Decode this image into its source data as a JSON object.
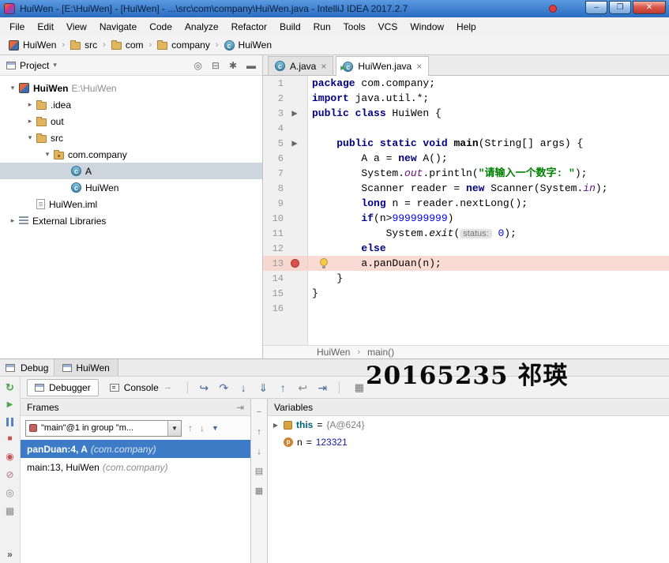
{
  "colors": {
    "titlebar_blue": "#2e74c8",
    "selection_blue": "#3e7bc6",
    "breakpoint_line_pink": "#fadbd3",
    "breakpoint_red": "#d94f49",
    "keyword": "#000080",
    "string": "#008000",
    "number": "#0000ff",
    "field": "#660e7a",
    "tree_selection": "#cdd6df"
  },
  "titlebar": {
    "title": "HuiWen - [E:\\HuiWen] - [HuiWen] - ...\\src\\com\\company\\HuiWen.java - IntelliJ IDEA 2017.2.7",
    "controls": [
      "notification-icon",
      "minimize-icon",
      "maximize-icon",
      "close-icon"
    ]
  },
  "menu": {
    "items": [
      "File",
      "Edit",
      "View",
      "Navigate",
      "Code",
      "Analyze",
      "Refactor",
      "Build",
      "Run",
      "Tools",
      "VCS",
      "Window",
      "Help"
    ]
  },
  "navbar": {
    "items": [
      {
        "label": "HuiWen",
        "icon": "project-icon"
      },
      {
        "label": "src",
        "icon": "folder-icon"
      },
      {
        "label": "com",
        "icon": "folder-icon"
      },
      {
        "label": "company",
        "icon": "folder-icon"
      },
      {
        "label": "HuiWen",
        "icon": "class-icon"
      }
    ]
  },
  "project": {
    "title": "Project",
    "header_icons": [
      "locate-icon",
      "collapse-all-icon",
      "settings-icon",
      "hide-panel-icon"
    ],
    "tree": [
      {
        "label": "HuiWen",
        "suffix": " E:\\HuiWen",
        "icon": "project-icon",
        "chevron": "down",
        "level": 0,
        "bold": true
      },
      {
        "label": ".idea",
        "icon": "folder-icon",
        "chevron": "right",
        "level": 1
      },
      {
        "label": "out",
        "icon": "folder-icon",
        "chevron": "right",
        "level": 1
      },
      {
        "label": "src",
        "icon": "folder-icon",
        "chevron": "down",
        "level": 1
      },
      {
        "label": "com.company",
        "icon": "package-icon",
        "chevron": "down",
        "level": 2
      },
      {
        "label": "A",
        "icon": "class-icon",
        "level": 3,
        "selected": true
      },
      {
        "label": "HuiWen",
        "icon": "class-icon",
        "level": 3
      },
      {
        "label": "HuiWen.iml",
        "icon": "iml-file-icon",
        "level": 1
      },
      {
        "label": "External Libraries",
        "icon": "libraries-icon",
        "chevron": "right",
        "level": 0
      }
    ]
  },
  "editor": {
    "tabs": [
      {
        "label": "A.java",
        "icon": "class-icon",
        "active": false,
        "close": true
      },
      {
        "label": "HuiWen.java",
        "icon": "runnable-class-icon",
        "active": true,
        "close": true
      }
    ],
    "breadcrumb": [
      "HuiWen",
      "main()"
    ],
    "lines": [
      {
        "n": 1,
        "s": [
          [
            "kw",
            "package"
          ],
          [
            "pl",
            " com.company;"
          ]
        ]
      },
      {
        "n": 2,
        "s": [
          [
            "kw",
            "import"
          ],
          [
            "pl",
            " java.util.*;"
          ]
        ]
      },
      {
        "n": 3,
        "m": "run",
        "s": [
          [
            "kw",
            "public class"
          ],
          [
            "pl",
            " HuiWen {"
          ]
        ]
      },
      {
        "n": 4,
        "s": []
      },
      {
        "n": 5,
        "m": "run",
        "s": [
          [
            "pl",
            "    "
          ],
          [
            "kw",
            "public static void"
          ],
          [
            "pl",
            " "
          ],
          [
            "decl",
            "main"
          ],
          [
            "pl",
            "(String[] args) {"
          ]
        ]
      },
      {
        "n": 6,
        "s": [
          [
            "pl",
            "        A a = "
          ],
          [
            "kw",
            "new"
          ],
          [
            "pl",
            " A();"
          ]
        ]
      },
      {
        "n": 7,
        "s": [
          [
            "pl",
            "        System."
          ],
          [
            "fld",
            "out"
          ],
          [
            "pl",
            ".println("
          ],
          [
            "str",
            "\"请输入一个数字: \""
          ],
          [
            "pl",
            ");"
          ]
        ]
      },
      {
        "n": 8,
        "s": [
          [
            "pl",
            "        Scanner reader = "
          ],
          [
            "kw",
            "new"
          ],
          [
            "pl",
            " Scanner(System."
          ],
          [
            "fld",
            "in"
          ],
          [
            "pl",
            ");"
          ]
        ]
      },
      {
        "n": 9,
        "s": [
          [
            "pl",
            "        "
          ],
          [
            "kw",
            "long"
          ],
          [
            "pl",
            " n = reader.nextLong();"
          ]
        ]
      },
      {
        "n": 10,
        "s": [
          [
            "pl",
            "        "
          ],
          [
            "kw",
            "if"
          ],
          [
            "pl",
            "(n>"
          ],
          [
            "num",
            "999999999"
          ],
          [
            "pl",
            ")"
          ]
        ]
      },
      {
        "n": 11,
        "s": [
          [
            "pl",
            "            System."
          ],
          [
            "stm",
            "exit"
          ],
          [
            "pl",
            "("
          ],
          [
            "hint",
            "status:"
          ],
          [
            "pl",
            " "
          ],
          [
            "num",
            "0"
          ],
          [
            "pl",
            ");"
          ]
        ]
      },
      {
        "n": 12,
        "s": [
          [
            "pl",
            "        "
          ],
          [
            "kw",
            "else"
          ]
        ]
      },
      {
        "n": 13,
        "m": "bp",
        "hl": true,
        "bulb": true,
        "s": [
          [
            "pl",
            "        a.panDuan(n);"
          ]
        ]
      },
      {
        "n": 14,
        "s": [
          [
            "pl",
            "    }"
          ]
        ]
      },
      {
        "n": 15,
        "s": [
          [
            "pl",
            "}"
          ]
        ]
      },
      {
        "n": 16,
        "s": []
      }
    ]
  },
  "debug": {
    "window_label": "Debug",
    "session_tab": "HuiWen",
    "watermark": "20165235 祁瑛",
    "tool_tabs": [
      {
        "label": "Debugger",
        "icon": "debugger-icon",
        "active": true
      },
      {
        "label": "Console",
        "icon": "console-icon",
        "active": false,
        "trail_icon": "jump-to-end-icon"
      }
    ],
    "step_icons": [
      "show-execution-point-icon",
      "step-over-icon",
      "step-into-icon",
      "force-step-into-icon",
      "step-out-icon",
      "drop-frame-icon",
      "run-to-cursor-icon"
    ],
    "restore_layout_icon": "restore-layout-icon",
    "left_strip_icons": [
      "rerun-debug-icon",
      "resume-icon",
      "pause-icon",
      "stop-icon",
      "view-breakpoints-icon",
      "mute-breakpoints-icon",
      "thread-dump-icon",
      "grid-icon"
    ],
    "more_icon": "more-icon",
    "frames": {
      "title": "Frames",
      "pin_icon": "pin-icon",
      "thread_selector": "\"main\"@1 in group \"m...",
      "selector_icons": [
        "up-stack-icon",
        "down-stack-icon",
        "filter-icon"
      ],
      "rows": [
        {
          "text": "panDuan:4, A ",
          "pkg": "(com.company)",
          "selected": true
        },
        {
          "text": "main:13, HuiWen ",
          "pkg": "(com.company)",
          "selected": false
        }
      ]
    },
    "side_icons": [
      "hide-icon",
      "up-icon",
      "down-icon",
      "copy-icon",
      "export-icon"
    ],
    "variables": {
      "title": "Variables",
      "rows": [
        {
          "icon": "this-icon",
          "expandable": true,
          "name": "this",
          "eq": " = ",
          "value": "{A@624}",
          "type": "object",
          "highlight_name": true
        },
        {
          "icon": "parameter-icon",
          "expandable": false,
          "name": "n",
          "eq": " = ",
          "value": "123321",
          "type": "number",
          "highlight_name": false
        }
      ]
    }
  }
}
